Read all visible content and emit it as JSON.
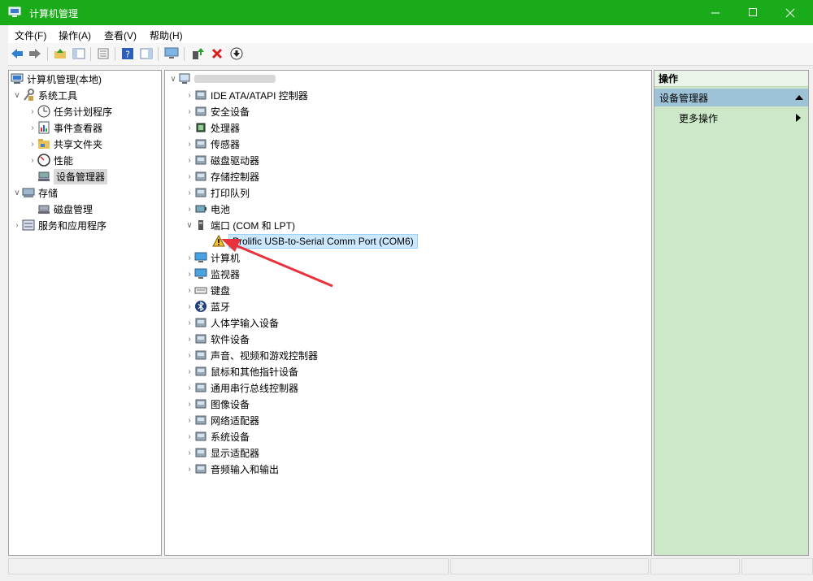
{
  "window": {
    "title": "计算机管理"
  },
  "menu": [
    "文件(F)",
    "操作(A)",
    "查看(V)",
    "帮助(H)"
  ],
  "left_tree": [
    {
      "label": "计算机管理(本地)",
      "level": 0,
      "arrow": "",
      "icon": "computer-management-icon"
    },
    {
      "label": "系统工具",
      "level": 1,
      "arrow": "down",
      "icon": "system-tools-icon"
    },
    {
      "label": "任务计划程序",
      "level": 2,
      "arrow": "right",
      "icon": "task-scheduler-icon"
    },
    {
      "label": "事件查看器",
      "level": 2,
      "arrow": "right",
      "icon": "event-viewer-icon"
    },
    {
      "label": "共享文件夹",
      "level": 2,
      "arrow": "right",
      "icon": "shared-folder-icon"
    },
    {
      "label": "性能",
      "level": 2,
      "arrow": "right",
      "icon": "performance-icon"
    },
    {
      "label": "设备管理器",
      "level": 2,
      "arrow": "",
      "icon": "device-manager-icon",
      "selected": true
    },
    {
      "label": "存储",
      "level": 1,
      "arrow": "down",
      "icon": "storage-icon"
    },
    {
      "label": "磁盘管理",
      "level": 2,
      "arrow": "",
      "icon": "disk-management-icon"
    },
    {
      "label": "服务和应用程序",
      "level": 1,
      "arrow": "right",
      "icon": "services-icon"
    }
  ],
  "device_tree": [
    {
      "label": "IDE ATA/ATAPI 控制器",
      "level": 1,
      "arrow": "right",
      "icon": "ide-controller-icon"
    },
    {
      "label": "安全设备",
      "level": 1,
      "arrow": "right",
      "icon": "security-device-icon"
    },
    {
      "label": "处理器",
      "level": 1,
      "arrow": "right",
      "icon": "processor-icon"
    },
    {
      "label": "传感器",
      "level": 1,
      "arrow": "right",
      "icon": "sensor-icon"
    },
    {
      "label": "磁盘驱动器",
      "level": 1,
      "arrow": "right",
      "icon": "disk-drive-icon"
    },
    {
      "label": "存储控制器",
      "level": 1,
      "arrow": "right",
      "icon": "storage-controller-icon"
    },
    {
      "label": "打印队列",
      "level": 1,
      "arrow": "right",
      "icon": "printer-icon"
    },
    {
      "label": "电池",
      "level": 1,
      "arrow": "right",
      "icon": "battery-icon"
    },
    {
      "label": "端口 (COM 和 LPT)",
      "level": 1,
      "arrow": "down",
      "icon": "port-icon"
    },
    {
      "label": "Prolific USB-to-Serial Comm Port (COM6)",
      "level": 2,
      "arrow": "",
      "icon": "warning-icon",
      "selected": true
    },
    {
      "label": "计算机",
      "level": 1,
      "arrow": "right",
      "icon": "computer-icon"
    },
    {
      "label": "监视器",
      "level": 1,
      "arrow": "right",
      "icon": "monitor-icon"
    },
    {
      "label": "键盘",
      "level": 1,
      "arrow": "right",
      "icon": "keyboard-icon"
    },
    {
      "label": "蓝牙",
      "level": 1,
      "arrow": "right",
      "icon": "bluetooth-icon"
    },
    {
      "label": "人体学输入设备",
      "level": 1,
      "arrow": "right",
      "icon": "hid-icon"
    },
    {
      "label": "软件设备",
      "level": 1,
      "arrow": "right",
      "icon": "software-device-icon"
    },
    {
      "label": "声音、视频和游戏控制器",
      "level": 1,
      "arrow": "right",
      "icon": "sound-icon"
    },
    {
      "label": "鼠标和其他指针设备",
      "level": 1,
      "arrow": "right",
      "icon": "mouse-icon"
    },
    {
      "label": "通用串行总线控制器",
      "level": 1,
      "arrow": "right",
      "icon": "usb-icon"
    },
    {
      "label": "图像设备",
      "level": 1,
      "arrow": "right",
      "icon": "camera-icon"
    },
    {
      "label": "网络适配器",
      "level": 1,
      "arrow": "right",
      "icon": "network-adapter-icon"
    },
    {
      "label": "系统设备",
      "level": 1,
      "arrow": "right",
      "icon": "system-device-icon"
    },
    {
      "label": "显示适配器",
      "level": 1,
      "arrow": "right",
      "icon": "display-adapter-icon"
    },
    {
      "label": "音频输入和输出",
      "level": 1,
      "arrow": "right",
      "icon": "audio-io-icon"
    }
  ],
  "actions": {
    "header": "操作",
    "group": "设备管理器",
    "more": "更多操作"
  },
  "colors": {
    "titlebar": "#1aab1a",
    "actions_pane": "#cde8c9",
    "selection": "#cce8ff",
    "annotation_arrow": "#e8323c"
  }
}
